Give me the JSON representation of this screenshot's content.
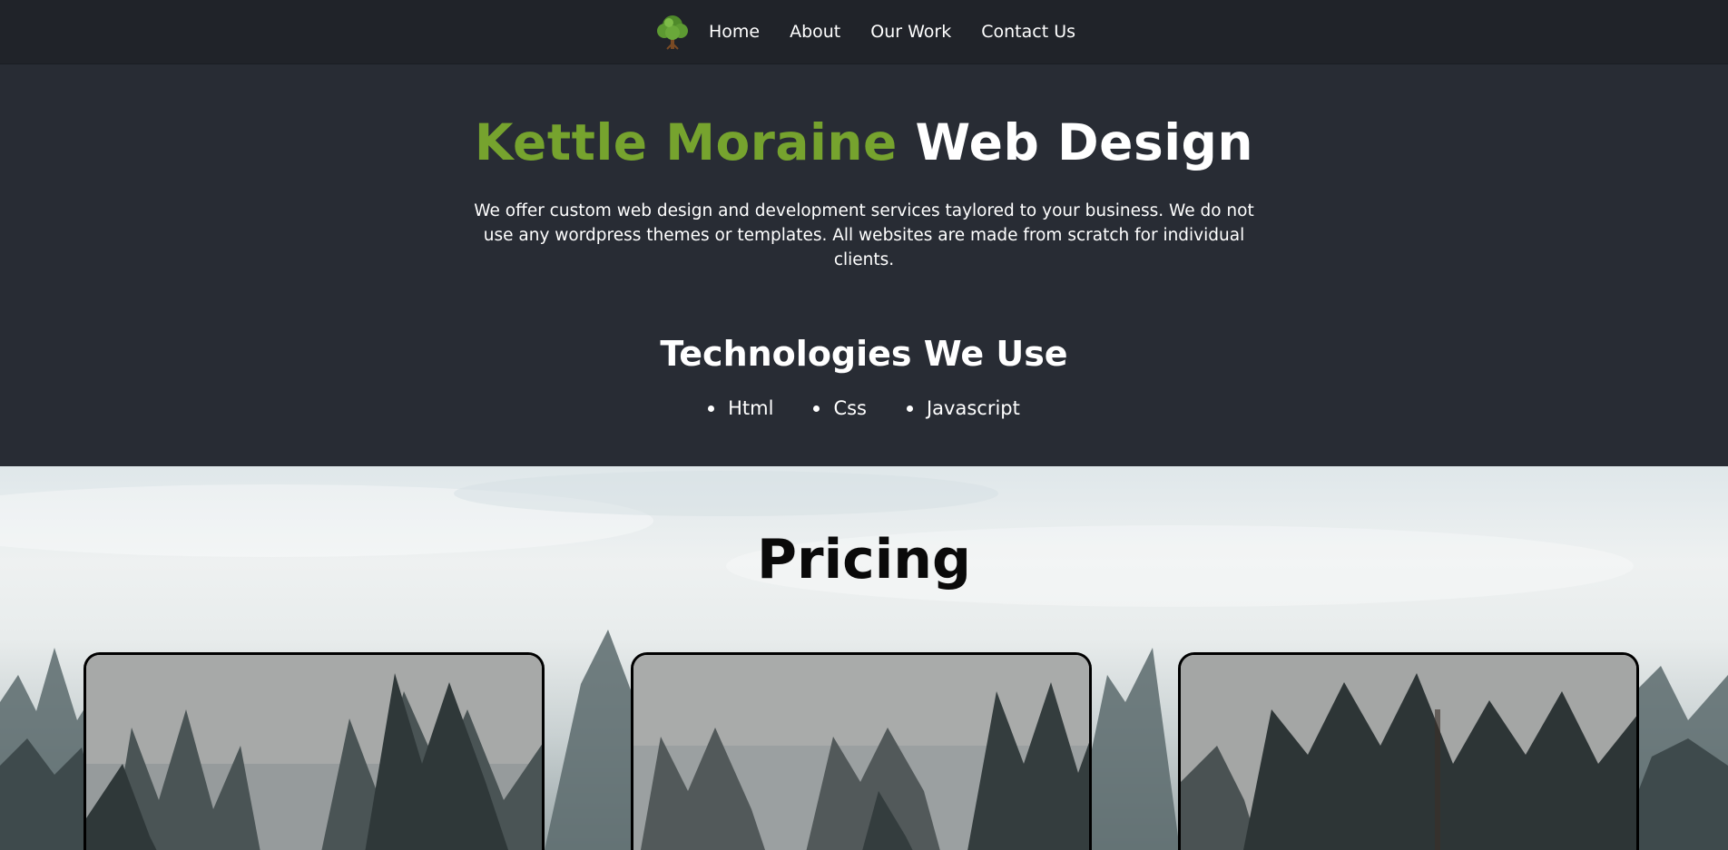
{
  "nav": {
    "logo_icon": "tree-icon",
    "links": [
      "Home",
      "About",
      "Our Work",
      "Contact Us"
    ]
  },
  "hero": {
    "title_accent": "Kettle Moraine",
    "title_rest": "Web Design",
    "description": "We offer custom web design and development services taylored to your business. We do not use any wordpress themes or templates. All websites are made from scratch for individual clients."
  },
  "technologies": {
    "title": "Technologies We Use",
    "items": [
      "Html",
      "Css",
      "Javascript"
    ]
  },
  "pricing": {
    "title": "Pricing"
  },
  "colors": {
    "accent": "#76a32e",
    "nav_bg": "#202329",
    "page_bg": "#282c34"
  }
}
